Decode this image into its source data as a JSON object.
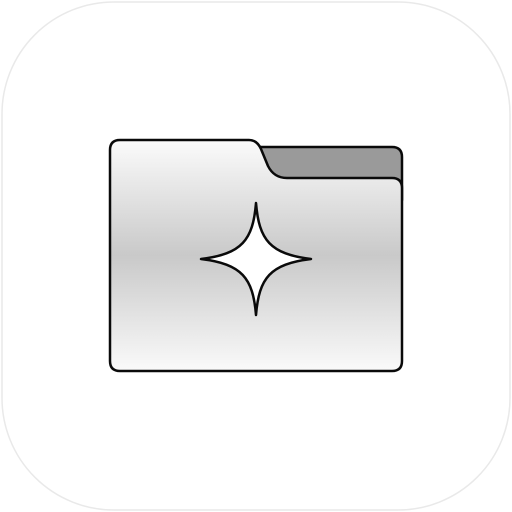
{
  "app_icon": {
    "icon_name": "folder-sparkle-icon",
    "tile_color": "#ffffff",
    "tile_border_color": "#e9e9e9",
    "folder_back_color": "#9a9a9a",
    "folder_front_gradient": [
      "#fbfbfb",
      "#c9c9c9",
      "#fafafa"
    ],
    "outline_color": "#0a0a0a",
    "sparkle_color": "#ffffff"
  }
}
